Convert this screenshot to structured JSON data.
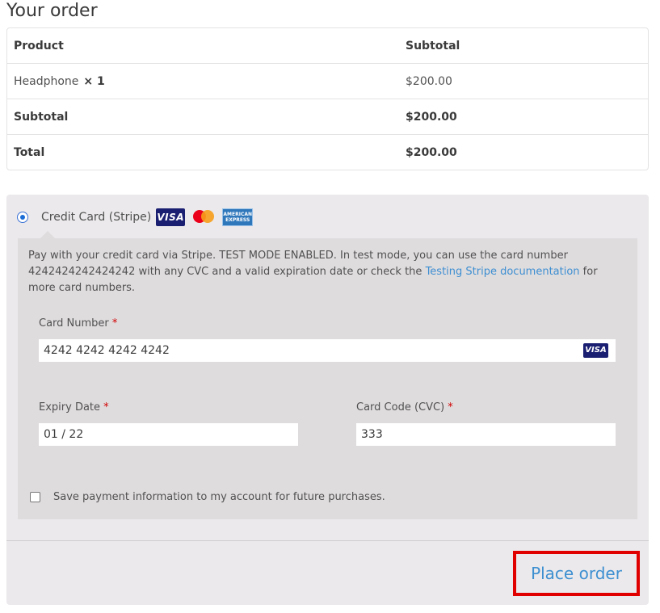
{
  "order": {
    "heading": "Your order",
    "columns": {
      "product": "Product",
      "subtotal": "Subtotal"
    },
    "items": [
      {
        "name": "Headphone",
        "qty": "× 1",
        "subtotal": "$200.00"
      }
    ],
    "subtotal_label": "Subtotal",
    "subtotal_value": "$200.00",
    "total_label": "Total",
    "total_value": "$200.00"
  },
  "payment": {
    "method_label": "Credit Card (Stripe)",
    "method_selected": true,
    "logos": {
      "visa": "VISA",
      "mastercard_icon": "mastercard-icon",
      "amex_line1": "AMERICAN",
      "amex_line2": "EXPRESS"
    },
    "description_part1": "Pay with your credit card via Stripe. TEST MODE ENABLED. In test mode, you can use the card number 4242424242424242 with any CVC and a valid expiration date or check the ",
    "description_link": "Testing Stripe documentation",
    "description_part2": " for more card numbers.",
    "card_number_label": "Card Number",
    "card_number_value": "4242 4242 4242 4242",
    "card_brand": "VISA",
    "expiry_label": "Expiry Date",
    "expiry_value": "01 / 22",
    "cvc_label": "Card Code (CVC)",
    "cvc_value": "333",
    "required_mark": "*",
    "save_label": "Save payment information to my account for future purchases.",
    "save_checked": false
  },
  "actions": {
    "place_order": "Place order"
  },
  "colors": {
    "link": "#3d8fd1",
    "highlight_border": "#e00000",
    "panel_bg": "#ebe9eb",
    "inner_panel_bg": "#dfdcde"
  }
}
